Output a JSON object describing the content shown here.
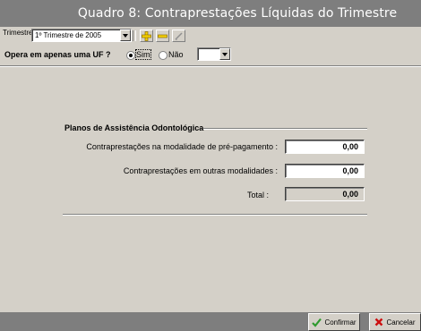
{
  "window": {
    "title": "Quadro 8: Contraprestações Líquidas do Trimestre"
  },
  "toolbar": {
    "trimestre_label": "Trimestre:",
    "trimestre_value": "1º Trimestre de 2005",
    "icons": [
      "add-icon",
      "remove-icon",
      "edit-icon"
    ]
  },
  "uf": {
    "question": "Opera em apenas uma UF ?",
    "sim_label": "Sim",
    "nao_label": "Não",
    "selected": "Sim",
    "uf_value": ""
  },
  "form": {
    "group_title": "Planos de Assistência Odontológica",
    "rows": [
      {
        "label": "Contraprestações na modalidade de pré-pagamento :",
        "value": "0,00"
      },
      {
        "label": "Contraprestações em outras modalidades :",
        "value": "0,00"
      },
      {
        "label": "Total :",
        "value": "0,00"
      }
    ]
  },
  "footer": {
    "confirm_label": "Confirmar",
    "cancel_label": "Cancelar",
    "colors": {
      "confirm_icon": "#2e9a2e",
      "cancel_icon": "#cc1010"
    }
  }
}
